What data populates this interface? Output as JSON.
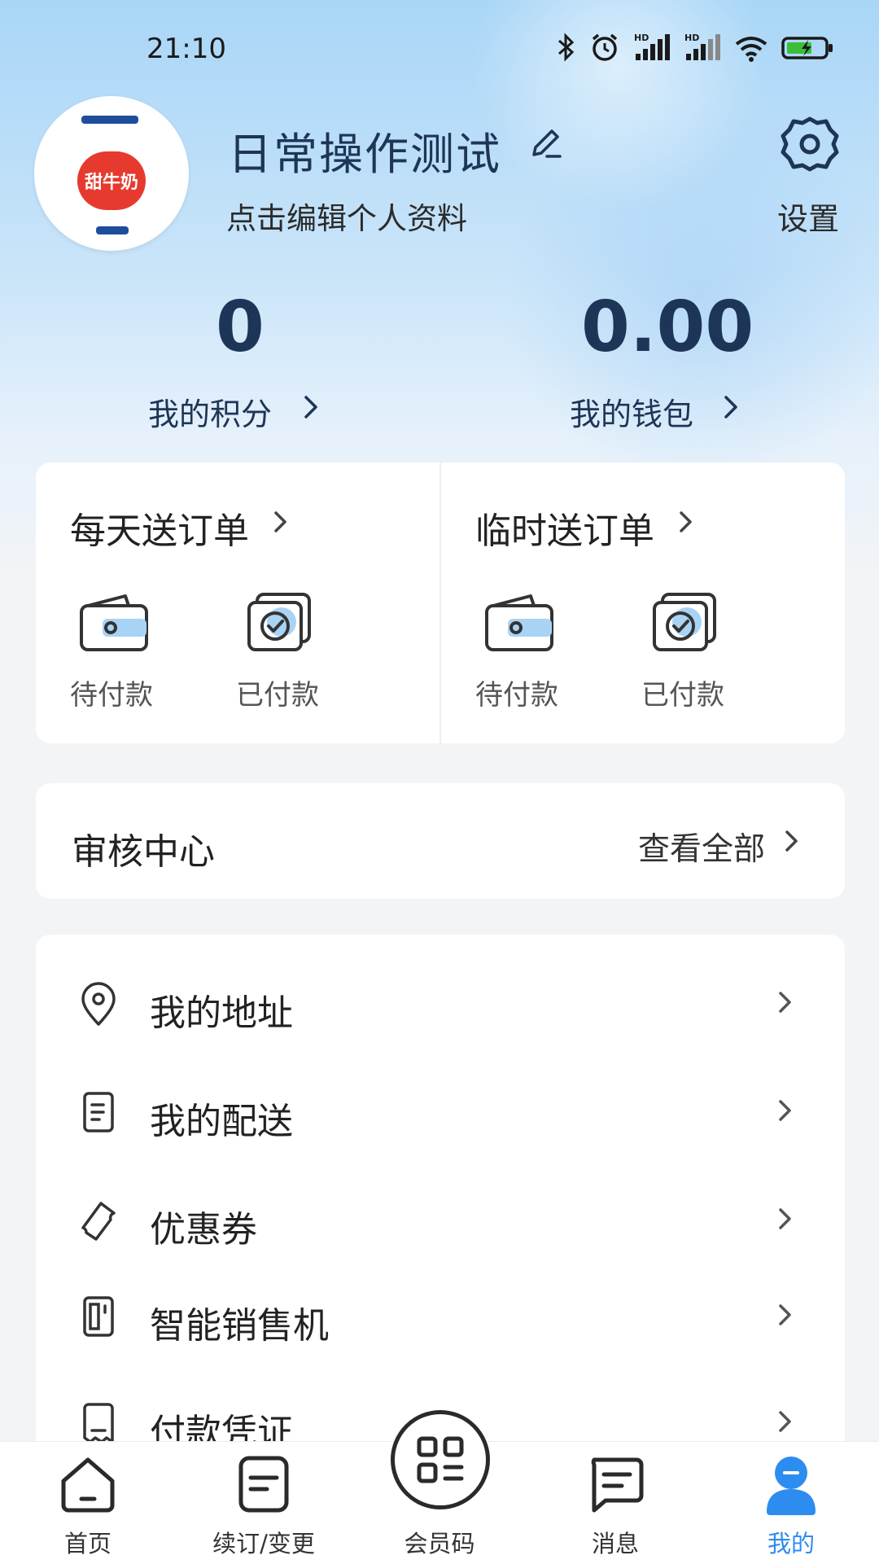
{
  "status_bar": {
    "time": "21:10"
  },
  "profile": {
    "name": "日常操作测试",
    "subtitle": "点击编辑个人资料",
    "avatar_text": "甜牛奶",
    "settings_label": "设置"
  },
  "stats": {
    "points_value": "0",
    "points_label": "我的积分",
    "wallet_value": "0.00",
    "wallet_label": "我的钱包"
  },
  "orders": {
    "daily": {
      "title": "每天送订单",
      "pending": "待付款",
      "paid": "已付款"
    },
    "temp": {
      "title": "临时送订单",
      "pending": "待付款",
      "paid": "已付款"
    }
  },
  "audit": {
    "title": "审核中心",
    "more": "查看全部"
  },
  "menu": {
    "items": [
      {
        "label": "我的地址",
        "icon": "location-icon"
      },
      {
        "label": "我的配送",
        "icon": "document-icon"
      },
      {
        "label": "优惠券",
        "icon": "coupon-icon"
      },
      {
        "label": "智能销售机",
        "icon": "vending-machine-icon"
      },
      {
        "label": "付款凭证",
        "icon": "receipt-icon"
      }
    ]
  },
  "tabbar": {
    "tabs": [
      {
        "label": "首页",
        "icon": "home-icon"
      },
      {
        "label": "续订/变更",
        "icon": "renew-icon"
      },
      {
        "label": "会员码",
        "icon": "qr-code-icon"
      },
      {
        "label": "消息",
        "icon": "message-icon"
      },
      {
        "label": "我的",
        "icon": "profile-icon",
        "active": true
      }
    ]
  },
  "colors": {
    "accent": "#2d8cf0",
    "title": "#1d3557",
    "icon_highlight": "#a9d3f5"
  }
}
